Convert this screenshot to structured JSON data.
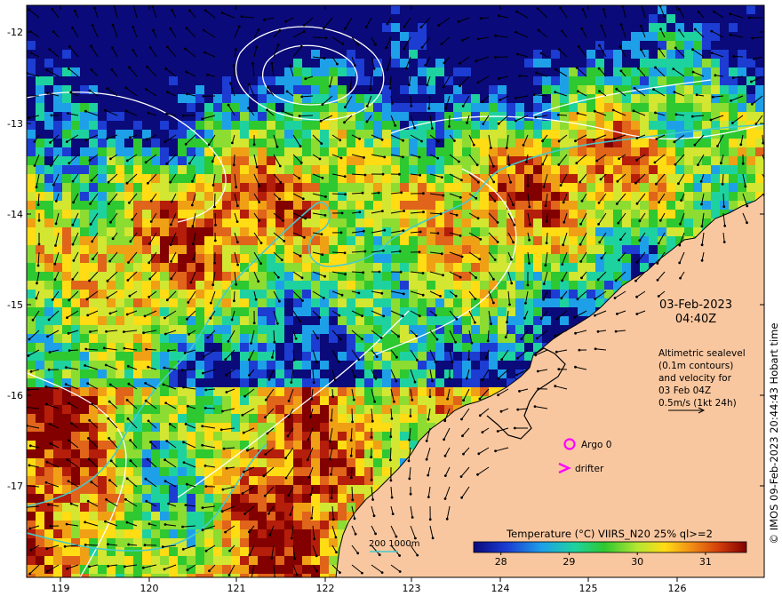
{
  "map": {
    "lon_ticks": [
      "119",
      "120",
      "121",
      "122",
      "123",
      "124",
      "125",
      "126"
    ],
    "lat_ticks": [
      "-12",
      "-13",
      "-14",
      "-15",
      "-16",
      "-17"
    ],
    "datetime": {
      "date": "03-Feb-2023",
      "time": "04:40Z"
    },
    "description_lines": [
      "Altimetric sealevel",
      "(0.1m contours)",
      "and velocity for",
      "03 Feb 04Z",
      "0.5m/s (1kt 24h)"
    ],
    "legend": {
      "argo_label": "Argo 0",
      "drifter_label": "drifter",
      "isobath_label": "200  1000m"
    },
    "colorbar": {
      "title": "Temperature (°C) VIIRS_N20 25% ql>=2",
      "tick_labels": [
        "28",
        "29",
        "30",
        "31"
      ],
      "range": [
        27.6,
        31.6
      ]
    },
    "credit": "© IMOS 09-Feb-2023 20:44:43 Hobart time",
    "colors": {
      "land": "#f9c79f",
      "argo_marker": "#ff00ff",
      "drifter_marker": "#ff00ff",
      "isobath": "#44cccc",
      "contour": "#ffffff",
      "arrow": "#000000"
    }
  }
}
